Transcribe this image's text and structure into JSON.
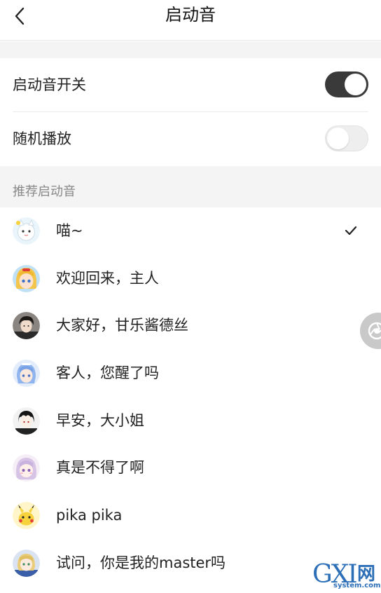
{
  "header": {
    "title": "启动音"
  },
  "settings": [
    {
      "label": "启动音开关",
      "toggle": "on"
    },
    {
      "label": "随机播放",
      "toggle": "off"
    }
  ],
  "section": {
    "title": "推荐启动音"
  },
  "sounds": [
    {
      "label": "喵~",
      "avatar": "white-cat-avatar",
      "selected": true
    },
    {
      "label": "欢迎回来，主人",
      "avatar": "blonde-girl-avatar",
      "selected": false
    },
    {
      "label": "大家好，甘乐酱德丝",
      "avatar": "dark-hair-guy-avatar",
      "selected": false
    },
    {
      "label": "客人，您醒了吗",
      "avatar": "blue-hair-maid-avatar",
      "selected": false
    },
    {
      "label": "早安，大小姐",
      "avatar": "butler-avatar",
      "selected": false
    },
    {
      "label": "真是不得了啊",
      "avatar": "lilac-hair-girl-avatar",
      "selected": false
    },
    {
      "label": "pika pika",
      "avatar": "pikachu-avatar",
      "selected": false
    },
    {
      "label": "试问，你是我的master吗",
      "avatar": "saber-avatar",
      "selected": false
    }
  ],
  "colors": {
    "toggle_on": "#3a3a3a",
    "section_bg": "#f4f4f4",
    "watermark": "#2d6fb7"
  },
  "watermark": {
    "letters": "GXI",
    "wang": "网",
    "domain": "system.com"
  }
}
